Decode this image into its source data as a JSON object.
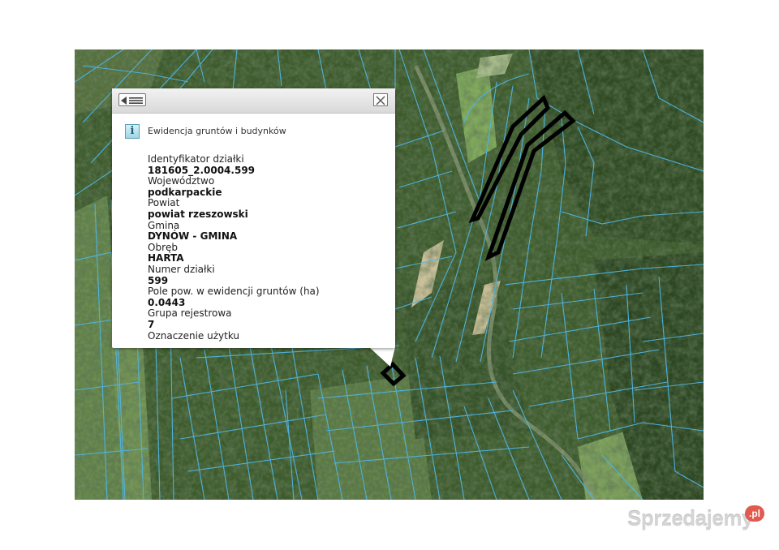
{
  "popup": {
    "section_title": "Ewidencja gruntów i budynków",
    "info_icon": "i",
    "back_icon": "list-back-icon",
    "close_icon": "close-icon",
    "fields": [
      {
        "label": "Identyfikator działki",
        "value": "181605_2.0004.599"
      },
      {
        "label": "Województwo",
        "value": "podkarpackie"
      },
      {
        "label": "Powiat",
        "value": "powiat rzeszowski"
      },
      {
        "label": "Gmina",
        "value": "DYNÓW - GMINA"
      },
      {
        "label": "Obręb",
        "value": "HARTA"
      },
      {
        "label": "Numer działki",
        "value": "599"
      },
      {
        "label": "Pole pow. w ewidencji gruntów (ha)",
        "value": "0.0443"
      },
      {
        "label": "Grupa rejestrowa",
        "value": "7"
      },
      {
        "label": "Oznaczenie użytku",
        "value": ""
      }
    ]
  },
  "map": {
    "parcel_line_color": "#4fb6e6",
    "highlight_color": "#000000",
    "forest_color": "#3c5a2c",
    "meadow_color": "#7ea45a"
  },
  "watermark": {
    "brand": "Sprzedajemy",
    "tld": ".pl"
  }
}
